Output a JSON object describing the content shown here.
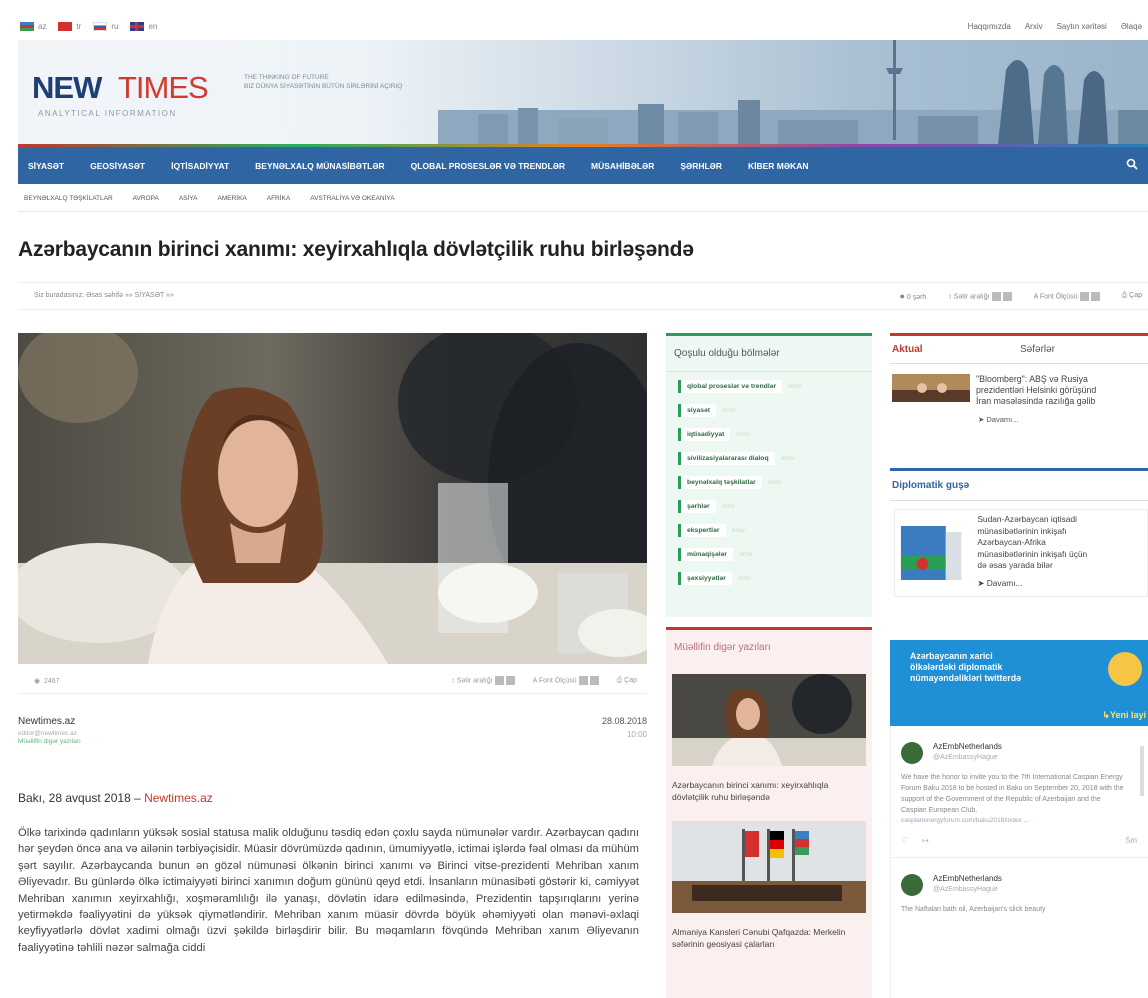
{
  "languages": [
    {
      "code": "az",
      "colors": [
        "#3a7fc1",
        "#d3302f",
        "#3a9a5a"
      ]
    },
    {
      "code": "tr",
      "colors": [
        "#d3302f",
        "#d3302f",
        "#d3302f"
      ]
    },
    {
      "code": "ru",
      "colors": [
        "#ffffff",
        "#2a5cb8",
        "#d3302f"
      ]
    },
    {
      "code": "en",
      "colors": [
        "#2a3d8f",
        "#d3302f",
        "#2a3d8f"
      ]
    }
  ],
  "toplinks": [
    "Haqqımızda",
    "Arxiv",
    "Saytın xəritəsi",
    "Əlaqə"
  ],
  "logo": {
    "new": "NEW",
    "times": "TIMES",
    "sub": "ANALYTICAL INFORMATION"
  },
  "tagline": [
    "THE THINKING OF FUTURE",
    "BIZ DÜNYA SİYASƏTİNİN BÜTÜN SİRLƏRİNİ AÇIRIQ"
  ],
  "mainnav": [
    "SİYASƏT",
    "GEOSİYASƏT",
    "İQTİSADİYYAT",
    "BEYNƏLXALQ MÜNASİBƏTLƏR",
    "QLOBAL PROSESLƏR VƏ TRENDLƏR",
    "MÜSAHİBƏLƏR",
    "ŞƏRHLƏR",
    "KİBER MƏKAN"
  ],
  "subnav": [
    "BEYNƏLXALQ TƏŞKİLATLAR",
    "AVROPA",
    "ASİYA",
    "AMERİKA",
    "AFRİKA",
    "AVSTRALİYA VƏ OKEANİYA"
  ],
  "article": {
    "title": "Azərbaycanın birinci xanımı: xeyirxahlıqla dövlətçilik ruhu birləşəndə",
    "crumb": "Siz buradasınız: Əsas səhifə »» SİYASƏT »»",
    "tools": {
      "comments": "0 şərh",
      "spacing": "Sətir aralığı",
      "font": "Font Ölçüsü",
      "print": "Çap"
    },
    "views": "2467",
    "author": "Newtimes.az",
    "email": "editor@newtimes.az",
    "author_more": "Müəllifin digər yazıları",
    "date": "28.08.2018",
    "time": "10:00",
    "lead_prefix": "Bakı, 28 avqust 2018 – ",
    "lead_source": "Newtimes.az",
    "body": "Ölkə tarixində qadınların yüksək sosial statusa malik olduğunu təsdiq edən çoxlu sayda nümunələr vardır. Azərbaycan qadını hər şeydən öncə ana və ailənin tərbiyəçisidir. Müasir dövrümüzdə qadının, ümumiyyətlə, ictimai işlərdə fəal olması da mühüm şərt sayılır. Azərbaycanda bunun ən gözəl nümunəsi ölkənin birinci xanımı və Birinci vitse-prezidenti Mehriban xanım Əliyevadır. Bu günlərdə ölkə ictimaiyyəti birinci xanımın doğum gününü qeyd etdi. İnsanların münasibəti göstərir ki, cəmiyyət Mehriban xanımın xeyirxahlığı, xoşməramlılığı ilə yanaşı, dövlətin idarə edilməsində, Prezidentin tapşırıqlarını yerinə yetirməkdə fəaliyyətini də yüksək qiymətləndirir. Mehriban xanım müasir dövrdə böyük əhəmiyyəti olan mənəvi-əxlaqi keyfiyyətlərlə dövlət xadimi olmağı üzvi şəkildə birləşdirir bilir. Bu məqamların fövqündə Mehriban xanım Əliyevanın fəaliyyətinə təhlili nəzər salmağa ciddi"
  },
  "sections": {
    "heading": "Qoşulu olduğu bölmələr",
    "count_label": "Arxiv",
    "tags": [
      "qlobal proseslər və trendlər",
      "siyasət",
      "iqtisadiyyat",
      "sivilizasiyalararası dialoq",
      "beynəlxalq təşkilatlar",
      "şərhlər",
      "ekspertlər",
      "münaqişələr",
      "şəxsiyyətlər"
    ]
  },
  "other": {
    "heading": "Müəllifin digər yazıları",
    "items": [
      "Azərbaycanın birinci xanımı: xeyirxahlıqla dövlətçilik ruhu birləşəndə",
      "Almaniya Kansleri Cənubi Qafqazda: Merkelin səfərinin geosiyasi çalarları"
    ]
  },
  "actual": {
    "tab1": "Aktual",
    "tab2": "Səfərlər",
    "news": [
      "\"Bloomberg\": ABŞ və Rusiya",
      "prezidentləri Helsinki görüşünd",
      "İran məsələsində razılığa gəlib"
    ],
    "more": "Davamı..."
  },
  "diplo": {
    "heading": "Diplomatik guşə",
    "text": [
      "Sudan-Azərbaycan iqtisadi",
      "münasibətlərinin inkişafı",
      "Azərbaycan-Afrika",
      "münasibətlərinin inkişafı üçün",
      "də əsas yarada bilər"
    ],
    "more": "Davamı..."
  },
  "twitter": {
    "banner": [
      "Azərbaycanın xarici",
      "ölkələrdəki diplomatik",
      "nümayəndəlikləri twitterdə"
    ],
    "new": "Yeni layi",
    "tweets": [
      {
        "name": "AzEmbNetherlands",
        "handle": "@AzEmbassyHague",
        "text": "We have the honor to invite you to the 7th International Caspian Energy Forum Baku 2018 to be hosted in Baku on September 20, 2018 with the support of the Government of the Republic of Azerbaijan and the Caspian European Club.",
        "link": "caspianenergyforum.com/baku2018/index ...",
        "time": "5m"
      },
      {
        "name": "AzEmbNetherlands",
        "handle": "@AzEmbassyHague",
        "text": "The Naftalan bath oil, Azerbaijan's slick beauty",
        "link": "",
        "time": ""
      }
    ]
  },
  "colors": {
    "nav": "#2f65a3",
    "accent_red": "#c0392b",
    "accent_green": "#2a9d57",
    "twitter": "#1f8fd6"
  }
}
